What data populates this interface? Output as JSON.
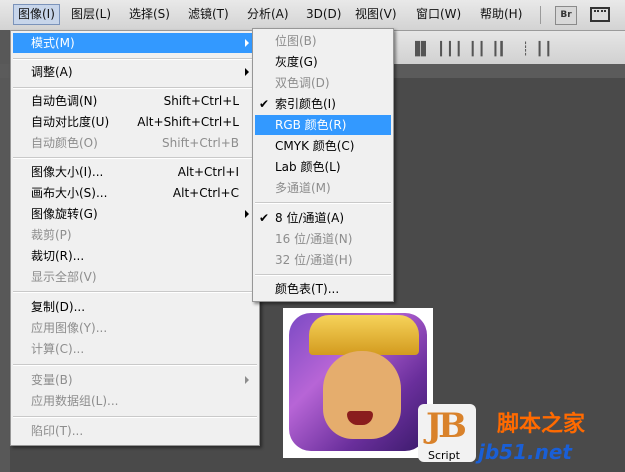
{
  "menubar": {
    "items": [
      {
        "label": "图像(I)",
        "active": true
      },
      {
        "label": "图层(L)"
      },
      {
        "label": "选择(S)"
      },
      {
        "label": "滤镜(T)"
      },
      {
        "label": "分析(A)"
      },
      {
        "label": "3D(D)"
      },
      {
        "label": "视图(V)"
      },
      {
        "label": "窗口(W)"
      },
      {
        "label": "帮助(H)"
      }
    ],
    "br_label": "Br"
  },
  "image_menu": {
    "items": [
      {
        "label": "模式(M)",
        "submenu": true,
        "highlighted": true
      },
      {
        "label": "调整(A)",
        "submenu": true
      },
      {
        "label": "自动色调(N)",
        "shortcut": "Shift+Ctrl+L"
      },
      {
        "label": "自动对比度(U)",
        "shortcut": "Alt+Shift+Ctrl+L"
      },
      {
        "label": "自动颜色(O)",
        "shortcut": "Shift+Ctrl+B",
        "disabled": true
      },
      {
        "label": "图像大小(I)...",
        "shortcut": "Alt+Ctrl+I"
      },
      {
        "label": "画布大小(S)...",
        "shortcut": "Alt+Ctrl+C"
      },
      {
        "label": "图像旋转(G)",
        "submenu": true
      },
      {
        "label": "裁剪(P)",
        "disabled": true
      },
      {
        "label": "裁切(R)..."
      },
      {
        "label": "显示全部(V)",
        "disabled": true
      },
      {
        "label": "复制(D)..."
      },
      {
        "label": "应用图像(Y)...",
        "disabled": true
      },
      {
        "label": "计算(C)...",
        "disabled": true
      },
      {
        "label": "变量(B)",
        "submenu": true,
        "disabled": true
      },
      {
        "label": "应用数据组(L)...",
        "disabled": true
      },
      {
        "label": "陷印(T)...",
        "disabled": true
      }
    ]
  },
  "mode_submenu": {
    "items": [
      {
        "label": "位图(B)",
        "disabled": true
      },
      {
        "label": "灰度(G)"
      },
      {
        "label": "双色调(D)",
        "disabled": true
      },
      {
        "label": "索引颜色(I)",
        "checked": true
      },
      {
        "label": "RGB 颜色(R)",
        "highlighted": true
      },
      {
        "label": "CMYK 颜色(C)"
      },
      {
        "label": "Lab 颜色(L)"
      },
      {
        "label": "多通道(M)",
        "disabled": true
      },
      {
        "label": "8 位/通道(A)",
        "checked": true
      },
      {
        "label": "16 位/通道(N)",
        "disabled": true
      },
      {
        "label": "32 位/通道(H)",
        "disabled": true
      },
      {
        "label": "颜色表(T)..."
      }
    ],
    "check_glyph": "✔"
  },
  "watermark": {
    "logo": "JB",
    "script": "Script",
    "site_name": "脚本之家",
    "site_url": "jb51.net"
  },
  "colors": {
    "highlight": "#3399ff",
    "menu_bg": "#f0f0f0",
    "disabled": "#8d8d8d"
  }
}
